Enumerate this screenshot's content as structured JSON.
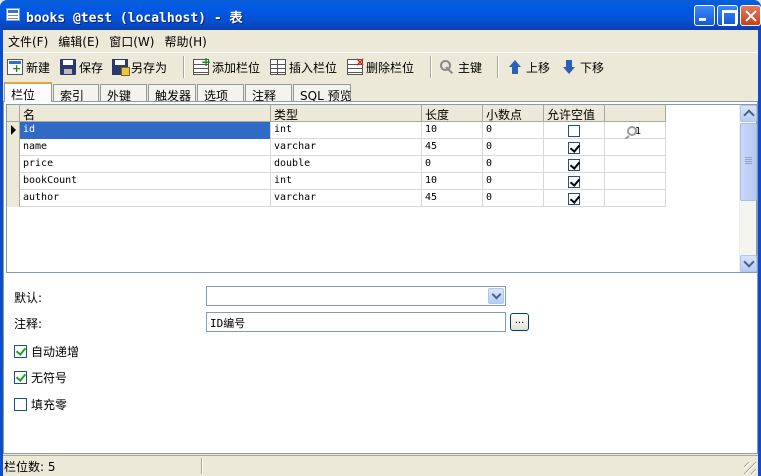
{
  "window": {
    "title": "books @test (localhost) - 表"
  },
  "menu": [
    "文件(F)",
    "编辑(E)",
    "窗口(W)",
    "帮助(H)"
  ],
  "toolbar": {
    "new": "新建",
    "save": "保存",
    "save_as": "另存为",
    "add_field": "添加栏位",
    "insert_field": "插入栏位",
    "delete_field": "删除栏位",
    "primary_key": "主键",
    "move_up": "上移",
    "move_down": "下移"
  },
  "tabs": [
    "栏位",
    "索引",
    "外键",
    "触发器",
    "选项",
    "注释",
    "SQL 预览"
  ],
  "grid": {
    "columns": [
      "名",
      "类型",
      "长度",
      "小数点",
      "允许空值",
      ""
    ],
    "rows": [
      {
        "name": "id",
        "type": "int",
        "length": "10",
        "decimals": "0",
        "nullable": false,
        "key": "1"
      },
      {
        "name": "name",
        "type": "varchar",
        "length": "45",
        "decimals": "0",
        "nullable": true,
        "key": ""
      },
      {
        "name": "price",
        "type": "double",
        "length": "0",
        "decimals": "0",
        "nullable": true,
        "key": ""
      },
      {
        "name": "bookCount",
        "type": "int",
        "length": "10",
        "decimals": "0",
        "nullable": true,
        "key": ""
      },
      {
        "name": "author",
        "type": "varchar",
        "length": "45",
        "decimals": "0",
        "nullable": true,
        "key": ""
      }
    ]
  },
  "props": {
    "default_label": "默认:",
    "default_value": "",
    "comment_label": "注释:",
    "comment_value": "ID编号",
    "ellipsis": "...",
    "auto_increment": {
      "label": "自动递增",
      "checked": true
    },
    "unsigned": {
      "label": "无符号",
      "checked": true
    },
    "zerofill": {
      "label": "填充零",
      "checked": false
    }
  },
  "status": {
    "field_count": "栏位数: 5"
  }
}
